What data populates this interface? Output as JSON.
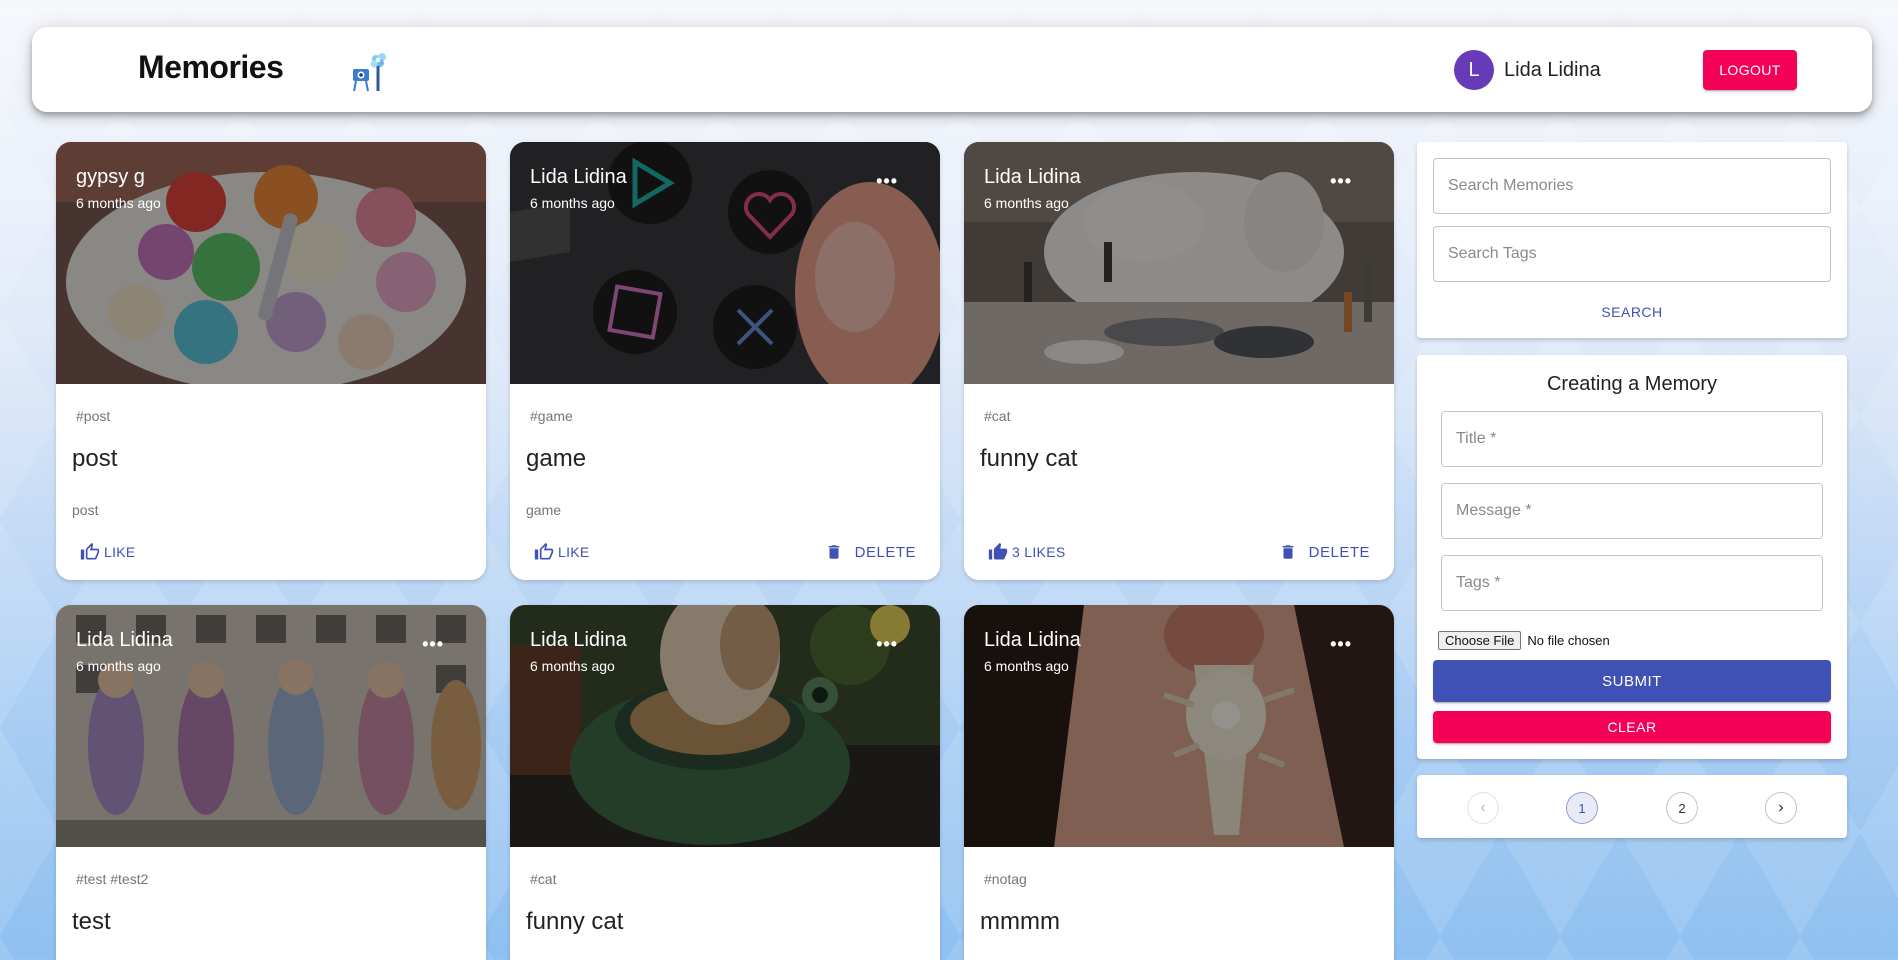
{
  "header": {
    "brand": "Memories",
    "brand_icon": "memories-logo-icon",
    "user": {
      "initial": "L",
      "name": "Lida Lidina",
      "avatar_color": "#673ab7"
    },
    "logout_label": "LOGOUT"
  },
  "posts": [
    {
      "author": "gypsy g",
      "time": "6 months ago",
      "tags": "#post",
      "title": "post",
      "message": "post",
      "like_label": "LIKE",
      "has_menu": false,
      "has_delete": false
    },
    {
      "author": "Lida Lidina",
      "time": "6 months ago",
      "tags": "#game",
      "title": "game",
      "message": "game",
      "like_label": "LIKE",
      "delete_label": "DELETE",
      "has_menu": true,
      "has_delete": true
    },
    {
      "author": "Lida Lidina",
      "time": "6 months ago",
      "tags": "#cat",
      "title": "funny cat",
      "message": "",
      "like_label": "3 LIKES",
      "delete_label": "DELETE",
      "has_menu": true,
      "has_delete": true
    },
    {
      "author": "Lida Lidina",
      "time": "6 months ago",
      "tags": "#test #test2",
      "title": "test",
      "has_menu": true
    },
    {
      "author": "Lida Lidina",
      "time": "6 months ago",
      "tags": "#cat",
      "title": "funny cat",
      "has_menu": true
    },
    {
      "author": "Lida Lidina",
      "time": "6 months ago",
      "tags": "#notag",
      "title": "mmmm",
      "has_menu": true
    }
  ],
  "search": {
    "memories_placeholder": "Search Memories",
    "tags_placeholder": "Search Tags",
    "button_label": "SEARCH"
  },
  "form": {
    "title": "Creating a Memory",
    "title_placeholder": "Title *",
    "message_placeholder": "Message *",
    "tags_placeholder": "Tags *",
    "file_button": "Choose File",
    "file_status": "No file chosen",
    "submit_label": "SUBMIT",
    "clear_label": "CLEAR"
  },
  "pagination": {
    "pages": [
      "1",
      "2"
    ],
    "current_page": 1
  },
  "colors": {
    "primary": "#3f51b5",
    "secondary": "#f50057",
    "avatar": "#673ab7"
  }
}
